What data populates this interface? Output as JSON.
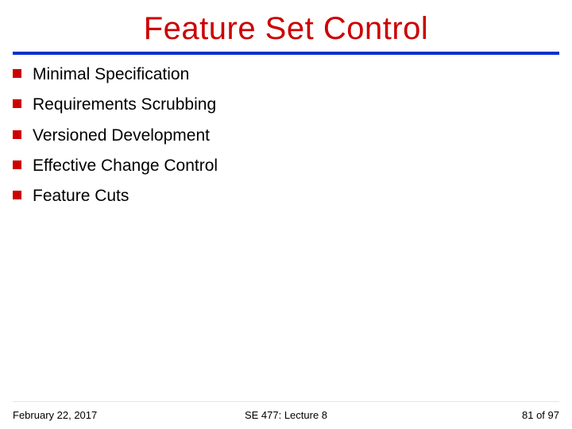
{
  "title": "Feature Set Control",
  "bullets": {
    "b0": "Minimal Specification",
    "b1": "Requirements Scrubbing",
    "b2": "Versioned Development",
    "b3": "Effective Change Control",
    "b4": "Feature Cuts"
  },
  "footer": {
    "date": "February 22, 2017",
    "course": "SE 477: Lecture 8",
    "page": "81 of 97"
  }
}
